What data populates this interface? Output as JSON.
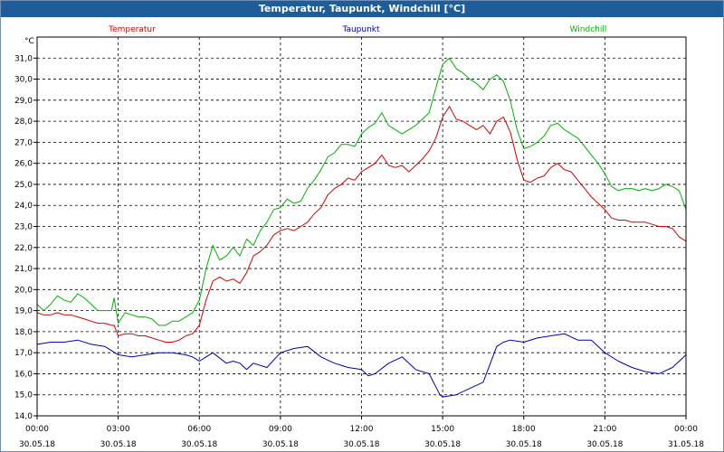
{
  "window": {
    "title": "Temperatur, Taupunkt, Windchill [°C]"
  },
  "chart_data": {
    "type": "line",
    "title": "Temperatur, Taupunkt, Windchill [°C]",
    "ylabel": "°C",
    "ylim": [
      14.0,
      32.0
    ],
    "yticks": [
      14.0,
      15.0,
      16.0,
      17.0,
      18.0,
      19.0,
      20.0,
      21.0,
      22.0,
      23.0,
      24.0,
      25.0,
      26.0,
      27.0,
      28.0,
      29.0,
      30.0,
      31.0
    ],
    "ytick_labels": [
      "14,0",
      "15,0",
      "16,0",
      "17,0",
      "18,0",
      "19,0",
      "20,0",
      "21,0",
      "22,0",
      "23,0",
      "24,0",
      "25,0",
      "26,0",
      "27,0",
      "28,0",
      "29,0",
      "30,0",
      "31,0"
    ],
    "xlim": [
      0,
      24
    ],
    "xtick_hours": [
      0,
      3,
      6,
      9,
      12,
      15,
      18,
      21,
      24
    ],
    "xtick_times": [
      "00:00",
      "03:00",
      "06:00",
      "09:00",
      "12:00",
      "15:00",
      "18:00",
      "21:00",
      "00:00"
    ],
    "xtick_dates": [
      "30.05.18",
      "30.05.18",
      "30.05.18",
      "30.05.18",
      "30.05.18",
      "30.05.18",
      "30.05.18",
      "30.05.18",
      "31.05.18"
    ],
    "grid": true,
    "series": [
      {
        "name": "Temperatur",
        "color": "#d40000",
        "x": [
          0,
          0.25,
          0.5,
          0.75,
          1.0,
          1.25,
          1.5,
          1.75,
          2.0,
          2.25,
          2.5,
          2.75,
          2.85,
          3.0,
          3.25,
          3.5,
          3.75,
          4.0,
          4.25,
          4.5,
          4.75,
          5.0,
          5.25,
          5.5,
          5.75,
          6.0,
          6.25,
          6.5,
          6.75,
          7.0,
          7.25,
          7.5,
          7.75,
          8.0,
          8.25,
          8.5,
          8.75,
          9.0,
          9.25,
          9.5,
          9.75,
          10.0,
          10.25,
          10.5,
          10.75,
          11.0,
          11.25,
          11.5,
          11.75,
          12.0,
          12.25,
          12.5,
          12.75,
          13.0,
          13.25,
          13.5,
          13.75,
          14.0,
          14.25,
          14.5,
          14.75,
          15.0,
          15.25,
          15.5,
          15.75,
          16.0,
          16.25,
          16.5,
          16.75,
          17.0,
          17.25,
          17.5,
          17.75,
          18.0,
          18.25,
          18.5,
          18.75,
          19.0,
          19.25,
          19.5,
          19.75,
          20.0,
          20.25,
          20.5,
          20.75,
          21.0,
          21.25,
          21.5,
          21.75,
          22.0,
          22.25,
          22.5,
          22.75,
          23.0,
          23.25,
          23.5,
          23.75,
          24.0
        ],
        "values": [
          18.9,
          18.8,
          18.8,
          18.9,
          18.8,
          18.8,
          18.7,
          18.6,
          18.5,
          18.4,
          18.4,
          18.3,
          18.3,
          17.8,
          17.9,
          17.9,
          17.8,
          17.8,
          17.7,
          17.6,
          17.5,
          17.5,
          17.6,
          17.8,
          17.9,
          18.3,
          19.5,
          20.4,
          20.6,
          20.4,
          20.5,
          20.3,
          20.8,
          21.6,
          21.8,
          22.1,
          22.6,
          22.8,
          22.9,
          22.8,
          23.0,
          23.2,
          23.6,
          23.9,
          24.5,
          24.8,
          25.0,
          25.3,
          25.2,
          25.6,
          25.8,
          26.0,
          26.4,
          25.9,
          25.8,
          25.9,
          25.6,
          25.9,
          26.2,
          26.6,
          27.2,
          28.2,
          28.7,
          28.1,
          28.0,
          27.8,
          27.6,
          27.8,
          27.4,
          28.0,
          28.2,
          27.5,
          26.2,
          25.2,
          25.1,
          25.3,
          25.4,
          25.8,
          26.0,
          25.7,
          25.6,
          25.2,
          24.8,
          24.4,
          24.1,
          23.8,
          23.4,
          23.3,
          23.3,
          23.2,
          23.2,
          23.2,
          23.1,
          23.0,
          23.0,
          22.9,
          22.5,
          22.3
        ]
      },
      {
        "name": "Taupunkt",
        "color": "#0000b8",
        "x": [
          0,
          0.5,
          1.0,
          1.5,
          2.0,
          2.5,
          3.0,
          3.5,
          4.0,
          4.5,
          5.0,
          5.5,
          5.75,
          6.0,
          6.25,
          6.5,
          7.0,
          7.25,
          7.5,
          7.75,
          8.0,
          8.5,
          9.0,
          9.5,
          10.0,
          10.5,
          11.0,
          11.5,
          12.0,
          12.25,
          12.5,
          13.0,
          13.5,
          14.0,
          14.5,
          14.9,
          15.0,
          15.25,
          15.5,
          16.0,
          16.5,
          17.0,
          17.25,
          17.5,
          18.0,
          18.5,
          19.0,
          19.5,
          20.0,
          20.5,
          21.0,
          21.5,
          22.0,
          22.5,
          23.0,
          23.5,
          24.0
        ],
        "values": [
          17.4,
          17.5,
          17.5,
          17.6,
          17.4,
          17.3,
          16.9,
          16.8,
          16.9,
          17.0,
          17.0,
          16.9,
          16.8,
          16.6,
          16.8,
          17.0,
          16.5,
          16.6,
          16.5,
          16.2,
          16.5,
          16.3,
          17.0,
          17.2,
          17.3,
          16.8,
          16.5,
          16.3,
          16.2,
          15.9,
          16.0,
          16.5,
          16.8,
          16.2,
          16.0,
          15.0,
          14.9,
          14.95,
          15.0,
          15.3,
          15.6,
          17.3,
          17.5,
          17.6,
          17.5,
          17.7,
          17.8,
          17.9,
          17.6,
          17.6,
          17.0,
          16.6,
          16.3,
          16.1,
          16.0,
          16.3,
          16.9
        ]
      },
      {
        "name": "Windchill",
        "color": "#00b400",
        "x": [
          0,
          0.25,
          0.5,
          0.75,
          1.0,
          1.25,
          1.5,
          1.75,
          2.0,
          2.25,
          2.5,
          2.75,
          2.85,
          3.0,
          3.25,
          3.5,
          3.75,
          4.0,
          4.25,
          4.5,
          4.75,
          5.0,
          5.25,
          5.5,
          5.75,
          6.0,
          6.25,
          6.5,
          6.75,
          7.0,
          7.25,
          7.5,
          7.75,
          8.0,
          8.25,
          8.5,
          8.75,
          9.0,
          9.25,
          9.5,
          9.75,
          10.0,
          10.25,
          10.5,
          10.75,
          11.0,
          11.25,
          11.5,
          11.75,
          12.0,
          12.25,
          12.5,
          12.75,
          13.0,
          13.25,
          13.5,
          13.75,
          14.0,
          14.25,
          14.5,
          14.75,
          15.0,
          15.25,
          15.5,
          15.75,
          16.0,
          16.25,
          16.5,
          16.75,
          17.0,
          17.25,
          17.5,
          17.75,
          18.0,
          18.25,
          18.5,
          18.75,
          19.0,
          19.25,
          19.5,
          19.75,
          20.0,
          20.25,
          20.5,
          20.75,
          21.0,
          21.25,
          21.5,
          21.75,
          22.0,
          22.25,
          22.5,
          22.75,
          23.0,
          23.25,
          23.5,
          23.75,
          24.0
        ],
        "values": [
          19.3,
          19.0,
          19.3,
          19.7,
          19.5,
          19.4,
          19.8,
          19.6,
          19.3,
          19.0,
          19.0,
          19.0,
          19.6,
          18.4,
          18.9,
          18.8,
          18.7,
          18.7,
          18.6,
          18.3,
          18.3,
          18.5,
          18.5,
          18.7,
          18.9,
          19.5,
          21.0,
          22.1,
          21.4,
          21.6,
          22.0,
          21.6,
          22.4,
          22.1,
          22.8,
          23.2,
          23.8,
          23.9,
          24.3,
          24.1,
          24.2,
          24.8,
          25.2,
          25.7,
          26.3,
          26.5,
          26.9,
          26.9,
          26.8,
          27.4,
          27.7,
          27.9,
          28.4,
          27.8,
          27.6,
          27.4,
          27.6,
          27.8,
          28.1,
          28.4,
          29.6,
          30.7,
          31.0,
          30.5,
          30.3,
          30.0,
          29.8,
          29.5,
          30.0,
          30.2,
          29.9,
          29.0,
          27.6,
          26.7,
          26.8,
          27.0,
          27.3,
          27.8,
          27.9,
          27.6,
          27.4,
          27.2,
          26.8,
          26.4,
          26.0,
          25.5,
          24.9,
          24.7,
          24.8,
          24.8,
          24.7,
          24.8,
          24.7,
          24.8,
          25.0,
          24.9,
          24.7,
          23.8
        ]
      }
    ]
  }
}
